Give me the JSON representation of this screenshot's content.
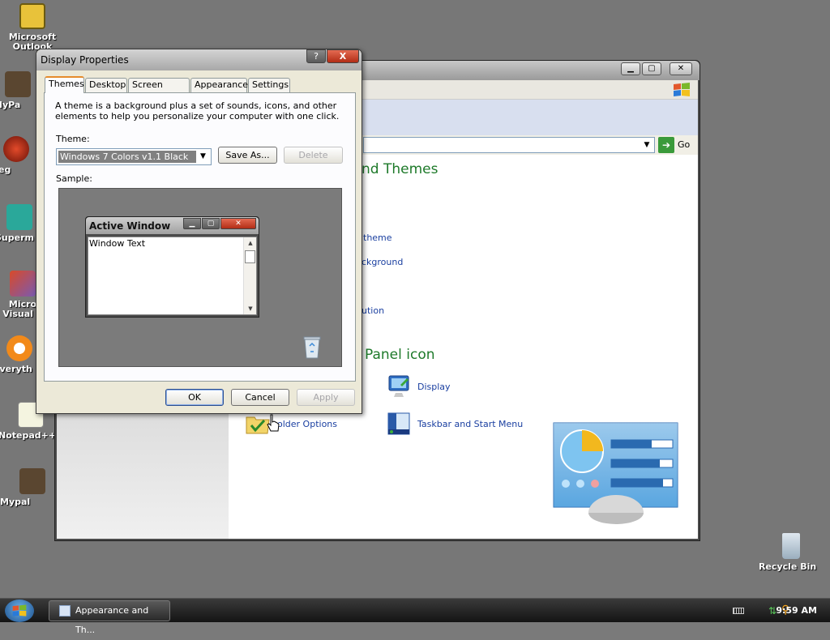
{
  "desktop": {
    "icons": [
      {
        "label": "Microsoft Outlook",
        "icon": "outlook-icon"
      },
      {
        "label": "MyPa",
        "icon": "mypal-icon"
      },
      {
        "label": "Peg",
        "icon": "pegasus-icon"
      },
      {
        "label": "Superm",
        "icon": "supermium-icon"
      },
      {
        "label": "Micro Visual S",
        "icon": "visual-studio-icon"
      },
      {
        "label": "Everyth",
        "icon": "everything-icon"
      },
      {
        "label": "Notepad++",
        "icon": "notepadpp-icon"
      },
      {
        "label": "Mypal",
        "icon": "mypal-icon"
      },
      {
        "label": "Recycle Bin",
        "icon": "recycle-bin-icon"
      }
    ]
  },
  "control_panel": {
    "go_label": "Go",
    "heading1": "nd Themes",
    "heading2": "Panel icon",
    "links": {
      "theme": "theme",
      "background": "ckground",
      "resolution": "ution",
      "display": "Display",
      "folder_options": "older Options",
      "taskbar": "Taskbar and Start Menu"
    }
  },
  "dialog": {
    "title": "Display Properties",
    "help_glyph": "?",
    "close_glyph": "X",
    "tabs": [
      "Themes",
      "Desktop",
      "Screen Saver",
      "Appearance",
      "Settings"
    ],
    "active_tab": "Themes",
    "description": "A theme is a background plus a set of sounds, icons, and other elements to help you personalize your computer with one click.",
    "theme_label": "Theme:",
    "theme_value": "Windows 7 Colors v1.1 Black",
    "save_as": "Save As...",
    "delete": "Delete",
    "sample_label": "Sample:",
    "sample": {
      "window_title": "Active Window",
      "window_text": "Window Text"
    },
    "ok": "OK",
    "cancel": "Cancel",
    "apply": "Apply"
  },
  "taskbar": {
    "task_label": "Appearance and Th...",
    "clock": "9:59 AM"
  },
  "colors": {
    "accent_green": "#1e7a2a",
    "link_blue": "#1a3fa0",
    "tab_highlight": "#e68b2c"
  }
}
